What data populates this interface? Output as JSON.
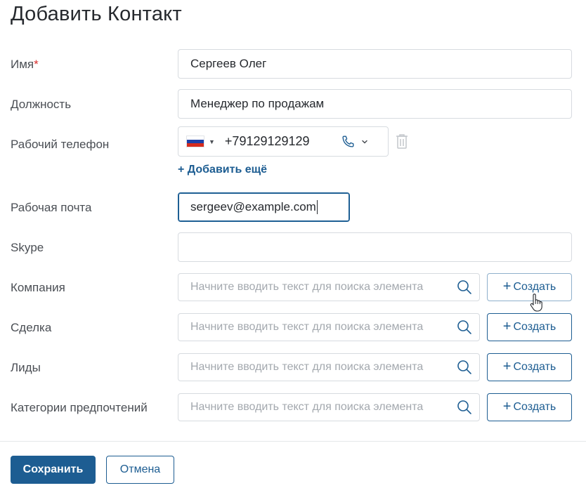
{
  "title": "Добавить Контакт",
  "fields": {
    "name": {
      "label": "Имя",
      "required_mark": "*",
      "value": "Сергеев Олег"
    },
    "position": {
      "label": "Должность",
      "value": "Менеджер по продажам"
    },
    "phone": {
      "label": "Рабочий телефон",
      "country_flag": "russia-flag-icon",
      "value": "+79129129129",
      "add_more": "+ Добавить ещё"
    },
    "email": {
      "label": "Рабочая почта",
      "value": "sergeev@example.com"
    },
    "skype": {
      "label": "Skype",
      "value": ""
    }
  },
  "lookups": [
    {
      "label": "Компания",
      "placeholder": "Начните вводить текст для поиска элемента",
      "create_label": "Создать"
    },
    {
      "label": "Сделка",
      "placeholder": "Начните вводить текст для поиска элемента",
      "create_label": "Создать"
    },
    {
      "label": "Лиды",
      "placeholder": "Начните вводить текст для поиска элемента",
      "create_label": "Создать"
    },
    {
      "label": "Категории предпочтений",
      "placeholder": "Начните вводить текст для поиска элемента",
      "create_label": "Создать"
    }
  ],
  "footer": {
    "save_label": "Сохранить",
    "cancel_label": "Отмена"
  },
  "colors": {
    "accent": "#1d5d92",
    "required": "#d9302f",
    "border": "#d7dbe0",
    "placeholder": "#a3a8ae"
  }
}
